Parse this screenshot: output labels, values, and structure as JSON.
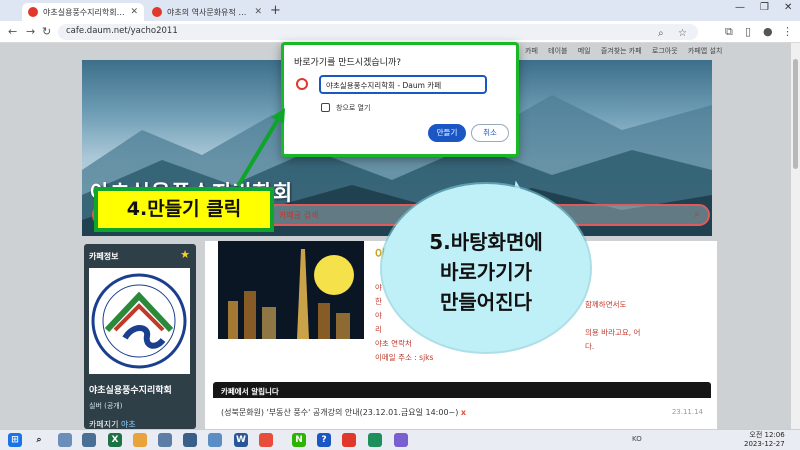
{
  "browser": {
    "tabs": [
      {
        "title": "야초실용풍수지리학회 - Daum",
        "active": true
      },
      {
        "title": "야초의 역사문화유적 답사 : 네",
        "active": false
      }
    ],
    "url": "cafe.daum.net/yacho2011"
  },
  "page": {
    "top_menu": [
      "카페",
      "테이블",
      "메일",
      "즐겨찾는 카페",
      "로그아웃",
      "카페앱 설치"
    ],
    "banner_title": "야초실용풍수지리학회",
    "search_hint": "카페글 검색",
    "sidebar": {
      "title": "카페정보",
      "cafe_name": "야초실용풍수지리학회",
      "member_label": "실버 (공개)",
      "invite_prefix": "카페지기",
      "invite_name": "야초"
    },
    "intro": {
      "title_fragment": "야",
      "line1": "야",
      "line2": "한",
      "line3": "야",
      "line4": "리",
      "line5": "야초 연락처",
      "line6": "이메일 주소 : sjks",
      "right1": "함께하면서도",
      "right2": "의용 바라고요, 어",
      "right3": "다."
    },
    "notice": {
      "header": "카페에서 알립니다",
      "item": "(성북문화원) '부동산 풍수' 공개강의 안내(23.12.01.금요일 14:00~)",
      "item_mark": "x",
      "date": "23.11.14"
    },
    "photo_sign": "우리는 서울의 롯데월드타워를"
  },
  "dialog": {
    "title": "바로가기를 만드시겠습니까?",
    "name_value": "야초실용풍수지리학회 - Daum 카페",
    "checkbox_label": "창으로 열기",
    "create_button": "만들기",
    "cancel_button": "취소"
  },
  "annotations": {
    "step4": "4.만들기 클릭",
    "step5_lines": [
      "5.바탕화면에",
      "바로가기가",
      "만들어진다"
    ]
  },
  "taskbar": {
    "clock_time": "오전 12:06",
    "clock_date": "2023-12-27",
    "tray_lang": "KO"
  },
  "colors": {
    "dialog_border": "#19b826",
    "annotation_yellow": "#ffff00",
    "speech_bubble": "#bff0f7",
    "primary_button": "#1a56c4"
  }
}
